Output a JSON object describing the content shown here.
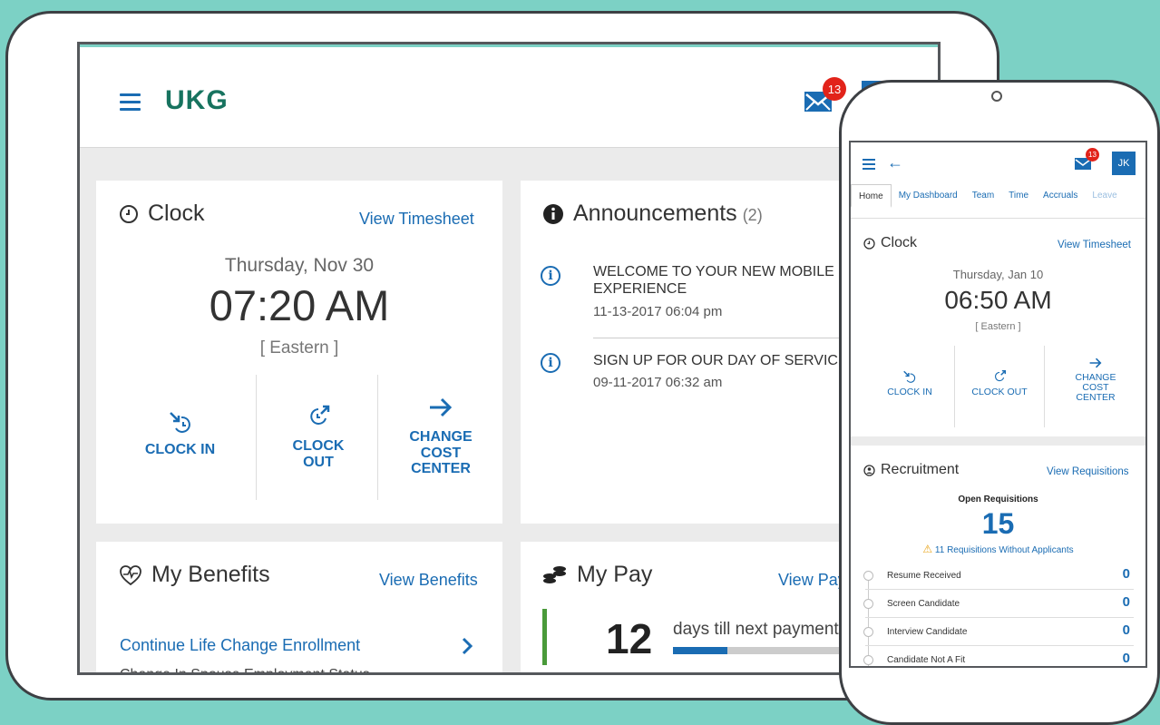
{
  "tablet": {
    "logo": "UKG",
    "mail_badge": "13",
    "clock": {
      "title": "Clock",
      "link": "View Timesheet",
      "date": "Thursday, Nov 30",
      "time": "07:20 AM",
      "timezone": "[ Eastern ]",
      "actions": [
        {
          "label_lines": [
            "CLOCK IN"
          ],
          "icon": "clock-in-icon"
        },
        {
          "label_lines": [
            "CLOCK",
            "OUT"
          ],
          "icon": "clock-out-icon"
        },
        {
          "label_lines": [
            "CHANGE",
            "COST",
            "CENTER"
          ],
          "icon": "arrow-right-icon"
        }
      ]
    },
    "announcements": {
      "title": "Announcements",
      "count": "(2)",
      "items": [
        {
          "title_lines": [
            "WELCOME TO YOUR NEW MOBILE",
            "EXPERIENCE"
          ],
          "date": "11-13-2017 06:04 pm"
        },
        {
          "title_lines": [
            "SIGN UP FOR OUR DAY OF SERVICE!"
          ],
          "date": "09-11-2017 06:32 am"
        }
      ]
    },
    "benefits": {
      "title": "My Benefits",
      "link": "View Benefits",
      "item_link": "Continue Life Change Enrollment",
      "item_sub": "Change In Spouse Employment Status"
    },
    "pay": {
      "title": "My Pay",
      "link": "View Pay",
      "days": "12",
      "days_label": "days till next payment",
      "progress": 0.2
    }
  },
  "phone": {
    "mail_badge": "13",
    "avatar": "JK",
    "tabs": [
      "Home",
      "My Dashboard",
      "Team",
      "Time",
      "Accruals",
      "Leave"
    ],
    "active_tab": "Home",
    "clock": {
      "title": "Clock",
      "link": "View Timesheet",
      "date": "Thursday, Jan 10",
      "time": "06:50 AM",
      "timezone": "[ Eastern ]",
      "actions": [
        {
          "label_lines": [
            "CLOCK IN"
          ]
        },
        {
          "label_lines": [
            "CLOCK OUT"
          ]
        },
        {
          "label_lines": [
            "CHANGE",
            "COST",
            "CENTER"
          ]
        }
      ]
    },
    "recruitment": {
      "title": "Recruitment",
      "link": "View Requisitions",
      "open_label": "Open Requisitions",
      "open_count": "15",
      "warning": "11 Requisitions Without Applicants",
      "stages": [
        {
          "label": "Resume Received",
          "count": "0"
        },
        {
          "label": "Screen Candidate",
          "count": "0"
        },
        {
          "label": "Interview Candidate",
          "count": "0"
        },
        {
          "label": "Candidate Not A Fit",
          "count": "0"
        }
      ]
    }
  },
  "colors": {
    "background": "#7cd1c5",
    "accent": "#1a6cb3",
    "brand": "#17735f",
    "badge": "#e2231a",
    "pay_bar": "#4a9a3a"
  }
}
